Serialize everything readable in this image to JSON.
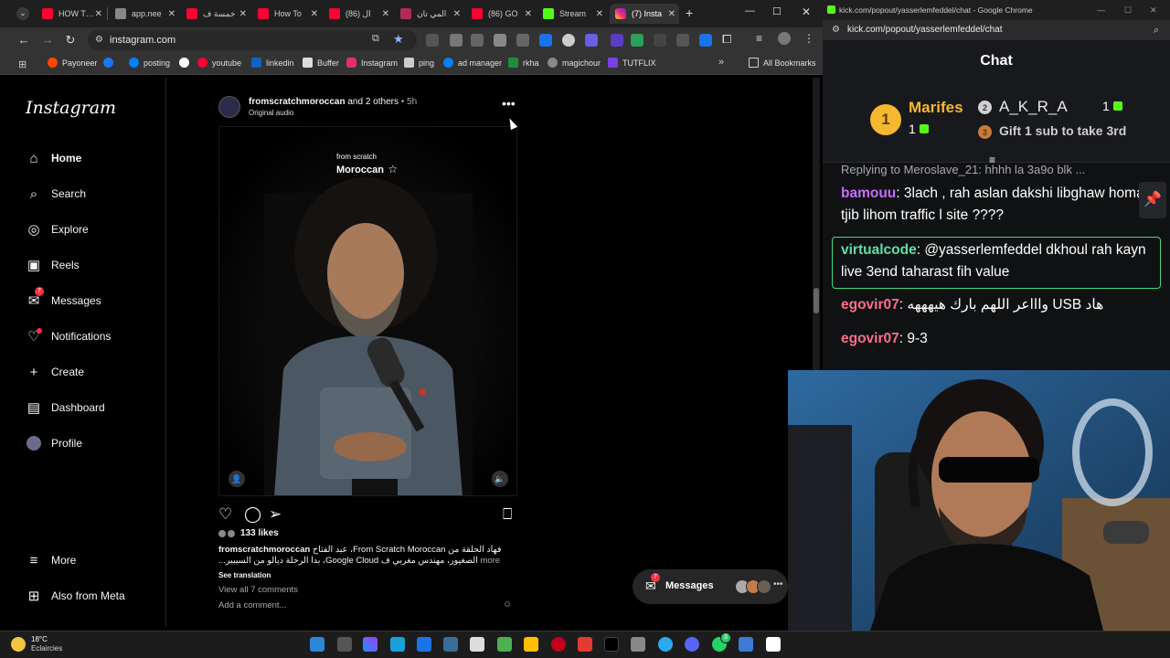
{
  "browser": {
    "tabs": [
      {
        "title": "HOW T…"
      },
      {
        "title": "app.nee"
      },
      {
        "title": "خمسة ف"
      },
      {
        "title": "How To"
      },
      {
        "title": "(86) ال"
      },
      {
        "title": "المي تان"
      },
      {
        "title": "(86) GO"
      },
      {
        "title": "Stream"
      },
      {
        "title": "(7) Insta"
      }
    ],
    "url": "instagram.com",
    "bookmarks": [
      "Payoneer",
      "posting",
      "youtube",
      "linkedin",
      "Buffer",
      "Instagram",
      "ping",
      "ad manager",
      "rkha",
      "magichour",
      "TUTFLIX"
    ],
    "all_bookmarks": "All Bookmarks"
  },
  "instagram": {
    "logo": "Instagram",
    "nav": [
      {
        "label": "Home",
        "icon": "home-icon"
      },
      {
        "label": "Search",
        "icon": "search-icon"
      },
      {
        "label": "Explore",
        "icon": "explore-icon"
      },
      {
        "label": "Reels",
        "icon": "reels-icon"
      },
      {
        "label": "Messages",
        "icon": "messenger-icon"
      },
      {
        "label": "Notifications",
        "icon": "heart-icon"
      },
      {
        "label": "Create",
        "icon": "plus-icon"
      },
      {
        "label": "Dashboard",
        "icon": "dashboard-icon"
      },
      {
        "label": "Profile",
        "icon": "profile-icon"
      }
    ],
    "messages_badge": "7",
    "more": "More",
    "also_from_meta": "Also from Meta",
    "post": {
      "user": "fromscratchmoroccan",
      "others": "and 2 others",
      "time": "• 5h",
      "audio": "Original audio",
      "reel_logo_small": "from scratch",
      "reel_logo_big": "Moroccan",
      "likes": "133 likes",
      "caption_user": "fromscratchmoroccan",
      "caption_line1": "فهاد الحلقة من From Scratch Moroccan، عبد الفتاح",
      "caption_line2": "الصغيور، مهندس مغربي ف Google Cloud، بدا الرحلة ديالو من السيبير...",
      "more": "more",
      "see_translation": "See translation",
      "view_comments": "View all 7 comments",
      "add_comment": "Add a comment..."
    },
    "messages_pill": {
      "label": "Messages",
      "badge": "7"
    }
  },
  "kick": {
    "window_title": "kick.com/popout/yasserlemfeddel/chat - Google Chrome",
    "url": "kick.com/popout/yasserlemfeddel/chat",
    "chat_title": "Chat",
    "leaderboard": {
      "first": {
        "rank": "1",
        "name": "Marifes",
        "count": "1"
      },
      "second": {
        "rank": "2",
        "name": "A_K_R_A",
        "count": "1"
      },
      "third": {
        "rank": "3",
        "text": "Gift 1 sub to take 3rd"
      }
    },
    "messages": [
      {
        "user": "",
        "text": "Replying to Meroslave_21: hhhh la 3a9o blk ..."
      },
      {
        "user": "bamouu",
        "text": ": 3lach , rah aslan dakshi libghaw homa, tjib lihom traffic l site ????"
      },
      {
        "user": "virtualcode",
        "text": ": @yasserlemfeddel dkhoul rah kayn live 3end taharast fih value"
      },
      {
        "user": "egovir07",
        "text": ": واااعر اللهم بارك هيهههه USB هاد"
      },
      {
        "user": "egovir07",
        "text": ": 9-3"
      }
    ]
  },
  "taskbar": {
    "temp": "18°C",
    "weather": "Eclaircies",
    "whatsapp_badge": "3"
  },
  "colors": {
    "kick_green": "#53fc18",
    "instagram_red": "#ff3040",
    "bamouu": "#c86cff",
    "virtualcode": "#5ce0a5",
    "egovir07": "#ff6d8a"
  }
}
